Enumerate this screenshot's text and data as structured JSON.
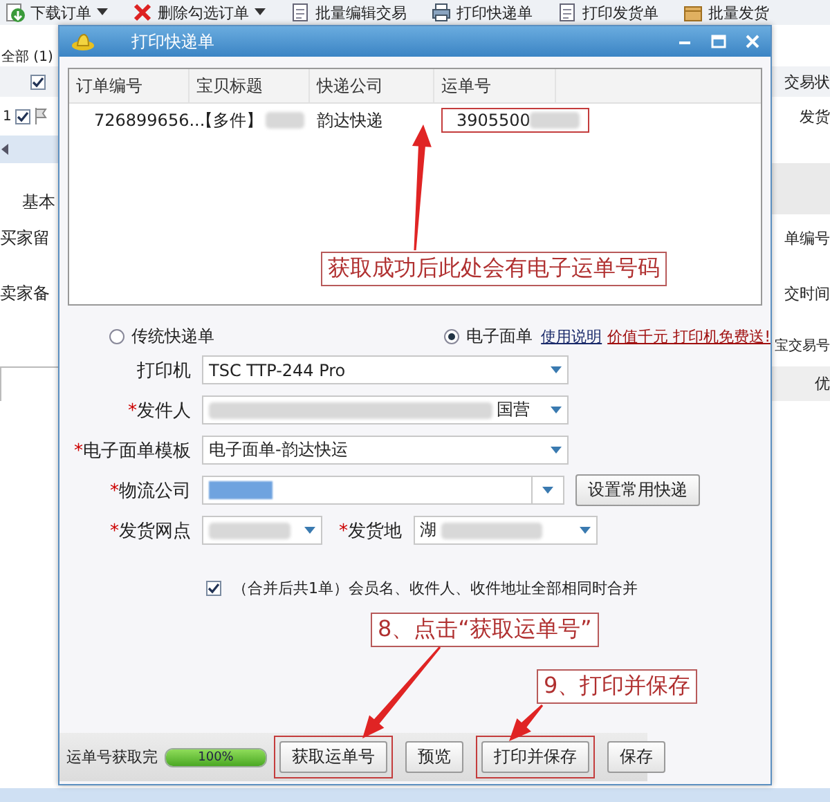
{
  "app": {
    "toolbar": [
      {
        "label": "下载订单",
        "caret": true
      },
      {
        "label": "删除勾选订单",
        "caret": true
      },
      {
        "label": "批量编辑交易",
        "caret": false
      },
      {
        "label": "打印快递单",
        "caret": false
      },
      {
        "label": "打印发货单",
        "caret": false
      },
      {
        "label": "批量发货",
        "caret": false
      }
    ],
    "filter_tab": "全部 (1)",
    "header_checked": true,
    "right_column": "交易状",
    "row_index": "1",
    "row_checked": true,
    "row_status": "发货",
    "detail_tab": "基本",
    "left_labels": [
      "买家留",
      "卖家备"
    ],
    "right_labels": [
      "单编号",
      "交时间",
      "宝交易号"
    ],
    "bottom_column": "优"
  },
  "dialog": {
    "title": "打印快递单",
    "table": {
      "columns": [
        "订单编号",
        "宝贝标题",
        "快递公司",
        "运单号"
      ],
      "rows": [
        {
          "cells": [
            {
              "text": "726899656...",
              "redacted": false,
              "highlighted": false
            },
            {
              "text": "【多件】",
              "redacted": true,
              "highlighted": false
            },
            {
              "text": "韵达快递",
              "redacted": false,
              "highlighted": false
            },
            {
              "text": "3905500",
              "redacted": true,
              "highlighted": true
            }
          ]
        }
      ]
    },
    "modes": [
      {
        "label": "传统快递单",
        "selected": false
      },
      {
        "label": "电子面单",
        "selected": true
      }
    ],
    "help_link": "使用说明",
    "promo_link": "价值千元 打印机免费送!",
    "fields": [
      {
        "kind": "select",
        "label": "打印机",
        "value": "TSC TTP-244 Pro",
        "redacted": false
      },
      {
        "kind": "select",
        "mark": "*",
        "label": "发件人",
        "value": "国营",
        "redacted": true,
        "value_last": true
      },
      {
        "kind": "select",
        "mark": "*",
        "label": "电子面单模板",
        "value": "电子面单-韵达快运",
        "redacted": false
      },
      {
        "kind": "combo",
        "mark": "*",
        "label": "物流公司",
        "redacted": true,
        "button": "设置常用快递"
      },
      {
        "kind": "pair",
        "items": [
          {
            "mark": "*",
            "label": "发货网点",
            "redacted": true
          },
          {
            "mark": "*",
            "label": "发货地",
            "value": "湖",
            "redacted": true
          }
        ]
      }
    ],
    "merge": {
      "checked": true,
      "label": "（合并后共1单）会员名、收件人、收件地址全部相同时合并"
    },
    "status": {
      "label": "运单号获取完",
      "level": 1,
      "reading": "100%"
    },
    "buttons": [
      {
        "label": "获取运单号",
        "highlighted": true
      },
      {
        "label": "预览",
        "highlighted": false
      },
      {
        "label": "打印并保存",
        "highlighted": true
      },
      {
        "label": "保存",
        "highlighted": false
      }
    ]
  },
  "annotations": [
    {
      "text": "获取成功后此处会有电子运单号码"
    },
    {
      "text": "8、点击“获取运单号”"
    },
    {
      "text": "9、打印并保存"
    }
  ]
}
